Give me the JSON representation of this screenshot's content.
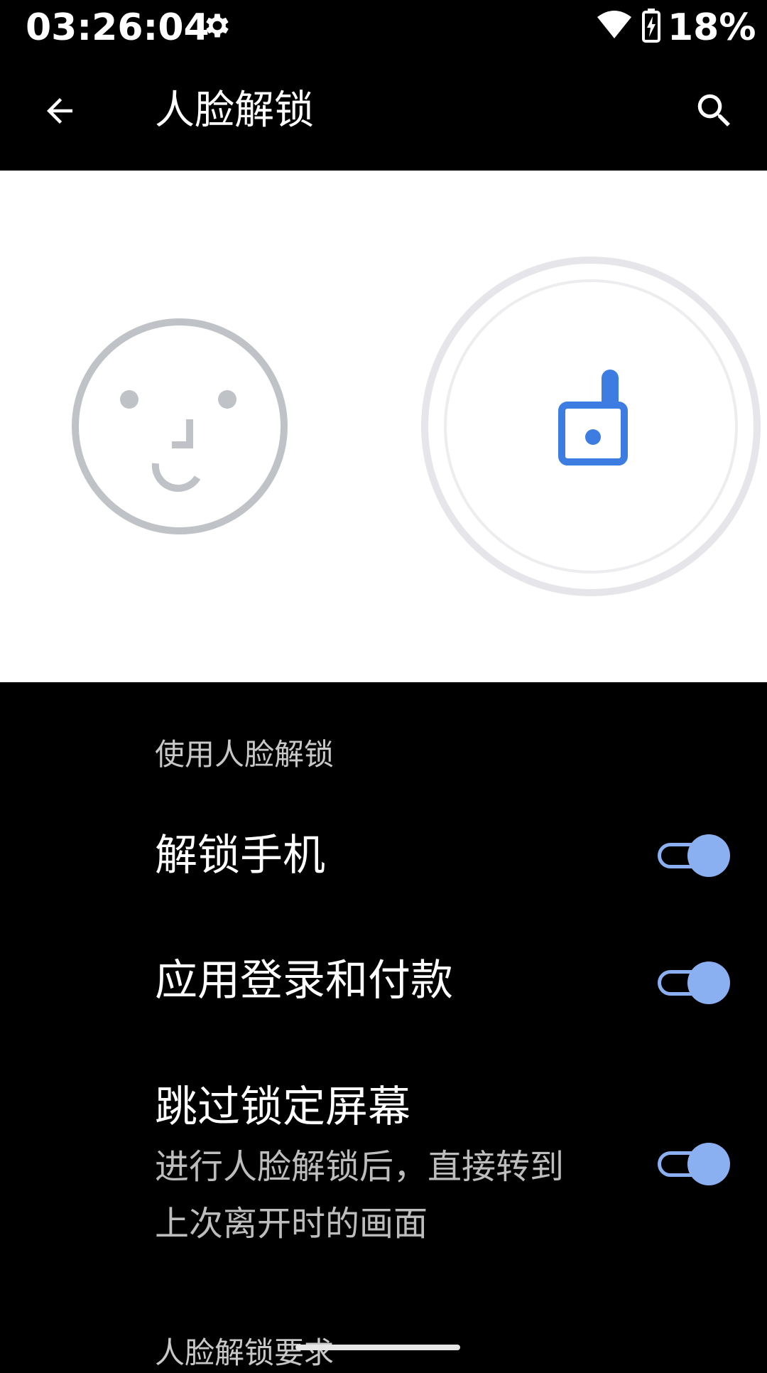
{
  "status_bar": {
    "time": "03:26:04",
    "battery_percent": "18%",
    "icons": [
      "gear-icon",
      "wifi-icon",
      "battery-charging-icon"
    ]
  },
  "app_bar": {
    "title": "人脸解锁",
    "icons": [
      "back-arrow-icon",
      "search-icon"
    ]
  },
  "illustration": {
    "icons": [
      "face-icon",
      "unlocked-lock-icon"
    ],
    "colors": {
      "face": "#bfc3c8",
      "lock": "#3d7ce0",
      "ring": "#e6e6ea"
    }
  },
  "settings": {
    "section_use": "使用人脸解锁",
    "items": [
      {
        "title": "解锁手机",
        "enabled": true
      },
      {
        "title": "应用登录和付款",
        "enabled": true
      },
      {
        "title": "跳过锁定屏幕",
        "summary": "进行人脸解锁后，直接转到上次离开时的画面",
        "enabled": true
      }
    ],
    "section_requirements": "人脸解锁要求"
  },
  "colors": {
    "background": "#000000",
    "toggle_accent": "#8ab0f2",
    "secondary_text": "#bdbdbd"
  }
}
